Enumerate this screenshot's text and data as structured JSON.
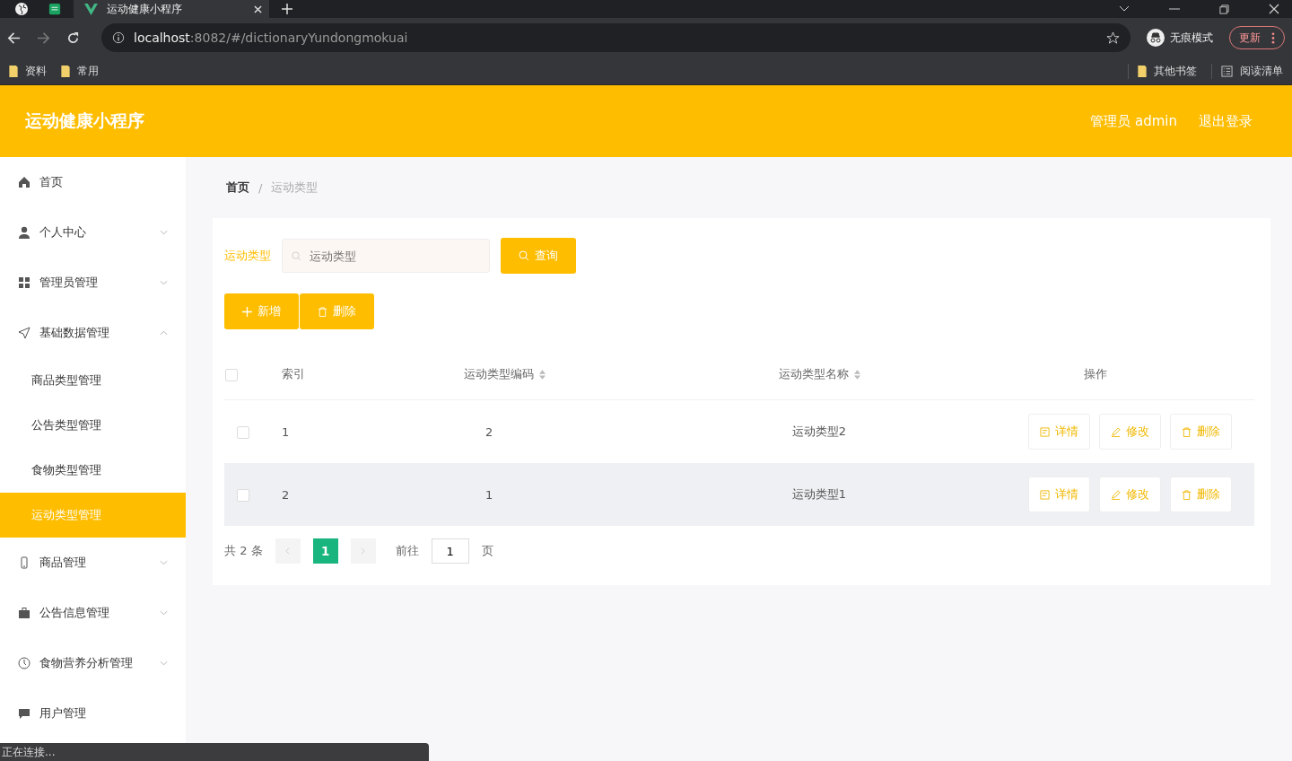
{
  "browser": {
    "tabs": [
      {
        "title": "运动健康小程序",
        "selected": true
      }
    ],
    "address": {
      "host": "localhost",
      "path": ":8082/#/dictionaryYundongmokuai"
    },
    "profile": "无痕模式",
    "update": "更新",
    "bookmarks": [
      "资料",
      "常用"
    ],
    "bookmarks_right": [
      {
        "label": "其他书签",
        "kind": "folder"
      },
      {
        "label": "阅读清单",
        "kind": "list"
      }
    ],
    "status": "正在连接..."
  },
  "header": {
    "title": "运动健康小程序",
    "user": "管理员 admin",
    "logout": "退出登录"
  },
  "sidebar": {
    "items": [
      {
        "label": "首页",
        "kind": "home",
        "expandable": false,
        "selected": false
      },
      {
        "label": "个人中心",
        "kind": "user",
        "expandable": true,
        "expanded": false,
        "selected": false
      },
      {
        "label": "管理员管理",
        "kind": "grid",
        "expandable": true,
        "expanded": false,
        "selected": false
      },
      {
        "label": "基础数据管理",
        "kind": "send",
        "expandable": true,
        "expanded": true,
        "selected": false,
        "children": [
          {
            "label": "商品类型管理",
            "selected": false
          },
          {
            "label": "公告类型管理",
            "selected": false
          },
          {
            "label": "食物类型管理",
            "selected": false
          },
          {
            "label": "运动类型管理",
            "selected": true
          }
        ]
      },
      {
        "label": "商品管理",
        "kind": "mobile",
        "expandable": true,
        "expanded": false,
        "selected": false
      },
      {
        "label": "公告信息管理",
        "kind": "briefcase",
        "expandable": true,
        "expanded": false,
        "selected": false
      },
      {
        "label": "食物营养分析管理",
        "kind": "clock",
        "expandable": true,
        "expanded": false,
        "selected": false
      },
      {
        "label": "用户管理",
        "kind": "chat",
        "expandable": false,
        "selected": false
      }
    ]
  },
  "breadcrumb": {
    "items": [
      "首页",
      "运动类型"
    ],
    "separator": "/"
  },
  "search": {
    "label": "运动类型",
    "placeholder": "运动类型",
    "button": "查询"
  },
  "actions": [
    {
      "label": "新增",
      "kind": "add"
    },
    {
      "label": "删除",
      "kind": "delete"
    }
  ],
  "table": {
    "all_checked": false,
    "columns": [
      {
        "label": "索引",
        "sortable": false
      },
      {
        "label": "运动类型编码",
        "sortable": true
      },
      {
        "label": "运动类型名称",
        "sortable": true
      },
      {
        "label": "操作",
        "sortable": false
      }
    ],
    "rows": [
      {
        "checked": false,
        "hovered": false,
        "index": "1",
        "code": "2",
        "name": "运动类型2",
        "buttons": [
          {
            "label": "详情",
            "kind": "detail"
          },
          {
            "label": "修改",
            "kind": "edit"
          },
          {
            "label": "删除",
            "kind": "delete"
          }
        ]
      },
      {
        "checked": false,
        "hovered": true,
        "index": "2",
        "code": "1",
        "name": "运动类型1",
        "buttons": [
          {
            "label": "详情",
            "kind": "detail"
          },
          {
            "label": "修改",
            "kind": "edit"
          },
          {
            "label": "删除",
            "kind": "delete"
          }
        ]
      }
    ]
  },
  "pagination": {
    "total": "共 2 条",
    "pages": [
      {
        "label": "1",
        "selected": true
      }
    ],
    "goto": "前往",
    "page": "1",
    "unit": "页"
  }
}
